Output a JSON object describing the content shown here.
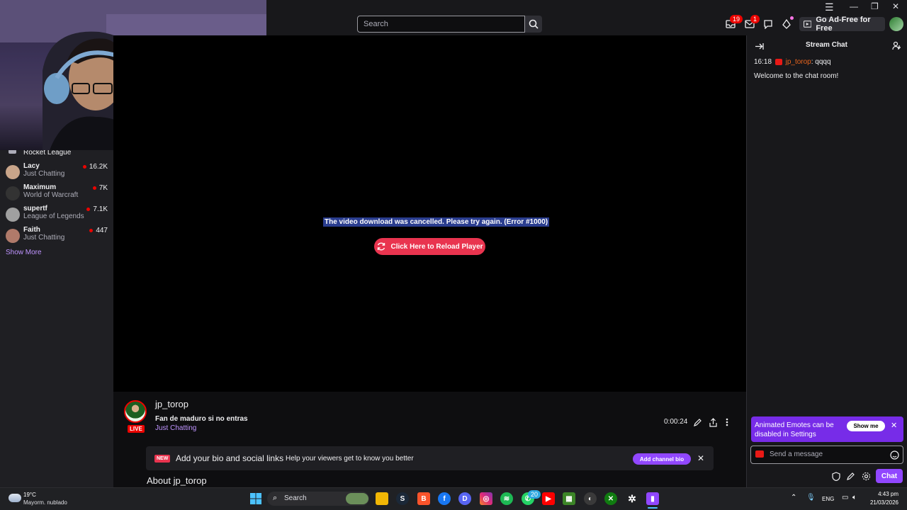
{
  "window": {
    "minimize": "—",
    "maximize": "❐",
    "close": "✕"
  },
  "header": {
    "search_placeholder": "Search",
    "notifications_badge": "19",
    "inbox_badge": "1",
    "ad_free_label": "Go Ad-Free for Free"
  },
  "sidebar": {
    "top_game": "Rocket League",
    "items": [
      {
        "name": "Lacy",
        "game": "Just Chatting",
        "viewers": "16.2K",
        "color": "#c9a58a"
      },
      {
        "name": "Maximum",
        "game": "World of Warcraft",
        "viewers": "7K",
        "color": "#333333"
      },
      {
        "name": "supertf",
        "game": "League of Legends",
        "viewers": "7.1K",
        "color": "#a0a0a0"
      },
      {
        "name": "Faith",
        "game": "Just Chatting",
        "viewers": "447",
        "color": "#b07a6a"
      }
    ],
    "show_more": "Show More"
  },
  "player": {
    "error": "The video download was cancelled. Please try again. (Error #1000)",
    "reload_label": "Click Here to Reload Player"
  },
  "channel": {
    "name": "jp_torop",
    "live": "LIVE",
    "title": "Fan de maduro si no entras",
    "category": "Just Chatting",
    "uptime": "0:00:24",
    "bio_new": "NEW",
    "bio_main": "Add your bio and social links",
    "bio_sub": "Help your viewers get to know you better",
    "bio_button": "Add channel bio",
    "about": "About jp_torop"
  },
  "chat": {
    "title": "Stream Chat",
    "message_time": "16:18",
    "message_user": "jp_torop",
    "message_text": ": qqqq",
    "welcome": "Welcome to the chat room!",
    "emote_banner": "Animated Emotes can be disabled in Settings",
    "show_me": "Show me",
    "input_placeholder": "Send a message",
    "chat_button": "Chat"
  },
  "taskbar": {
    "temp": "19°C",
    "weather": "Mayorm. nublado",
    "search": "Search",
    "whatsapp_badge": "20",
    "lang": "ENG",
    "time": "4:43 pm",
    "date": "21/03/2026"
  },
  "colors": {
    "accent": "#9147ff",
    "live": "#eb0400",
    "reload": "#e9344f",
    "link": "#bf94ff"
  }
}
